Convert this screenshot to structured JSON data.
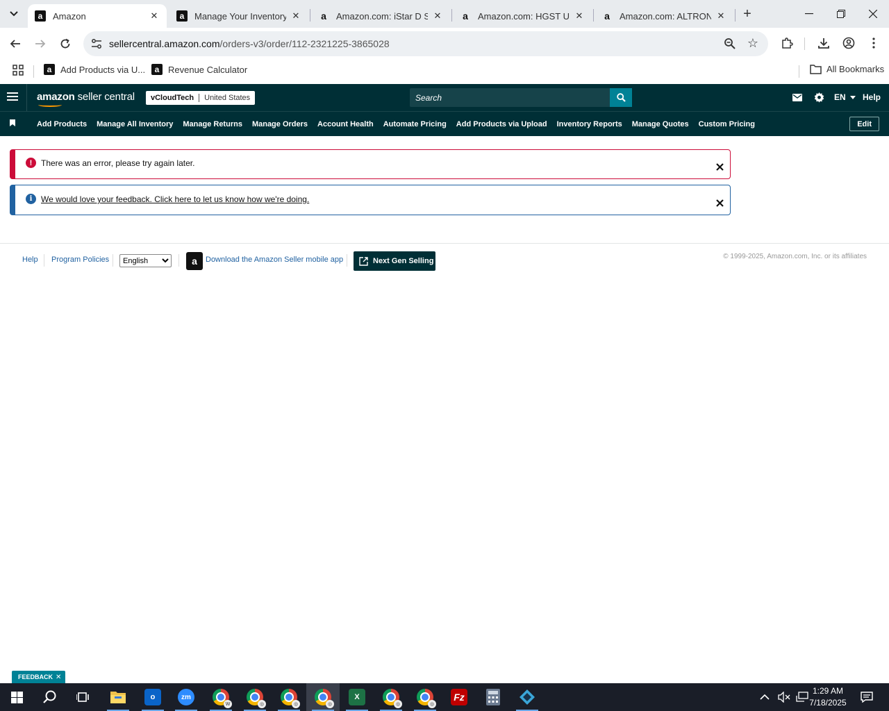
{
  "browser": {
    "tabs": [
      {
        "title": "Amazon",
        "active": true
      },
      {
        "title": "Manage Your Inventory",
        "active": false
      },
      {
        "title": "Amazon.com: iStar D Sto",
        "active": false
      },
      {
        "title": "Amazon.com: HGST Ultra",
        "active": false
      },
      {
        "title": "Amazon.com: ALTRONIX",
        "active": false
      }
    ],
    "url_domain": "sellercentral.amazon.com",
    "url_path": "/orders-v3/order/112-2321225-3865028",
    "bookmarks": [
      {
        "label": "Add Products via U..."
      },
      {
        "label": "Revenue Calculator"
      }
    ],
    "all_bookmarks": "All Bookmarks"
  },
  "header": {
    "logo_bold": "amazon",
    "logo_rest": " seller central",
    "account": "vCloudTech",
    "marketplace": "United States",
    "search_placeholder": "Search",
    "language": "EN",
    "help": "Help"
  },
  "nav": {
    "links": [
      "Add Products",
      "Manage All Inventory",
      "Manage Returns",
      "Manage Orders",
      "Account Health",
      "Automate Pricing",
      "Add Products via Upload",
      "Inventory Reports",
      "Manage Quotes",
      "Custom Pricing"
    ],
    "edit": "Edit"
  },
  "alerts": {
    "error": "There was an error, please try again later.",
    "info": "We would love your feedback. Click here to let us know how we're doing."
  },
  "footer": {
    "help": "Help",
    "program_policies": "Program Policies",
    "language_selected": "English",
    "download_app": "Download the Amazon Seller mobile app",
    "next_gen": "Next Gen Selling",
    "copyright": "© 1999-2025, Amazon.com, Inc. or its affiliates"
  },
  "feedback_tab": "FEEDBACK",
  "taskbar": {
    "time": "1:29 AM",
    "date": "7/18/2025"
  },
  "colors": {
    "sc_header": "#002f36",
    "error": "#cc0c39",
    "info": "#2162a1",
    "teal": "#008296"
  }
}
